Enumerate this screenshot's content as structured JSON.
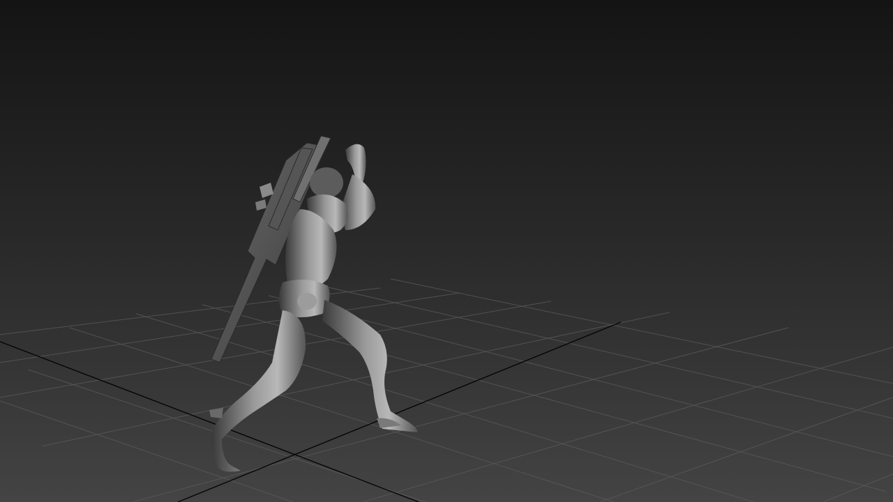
{
  "viewport": {
    "view": "perspective",
    "shading": "shaded",
    "grid": true,
    "colors": {
      "background_top": "#141414",
      "background_bottom": "#444444",
      "grid_line": "#5c5c5c",
      "axis_line": "#000000",
      "model_shade": "#8a8a8a"
    }
  },
  "scene": {
    "model": "character-with-sword"
  }
}
